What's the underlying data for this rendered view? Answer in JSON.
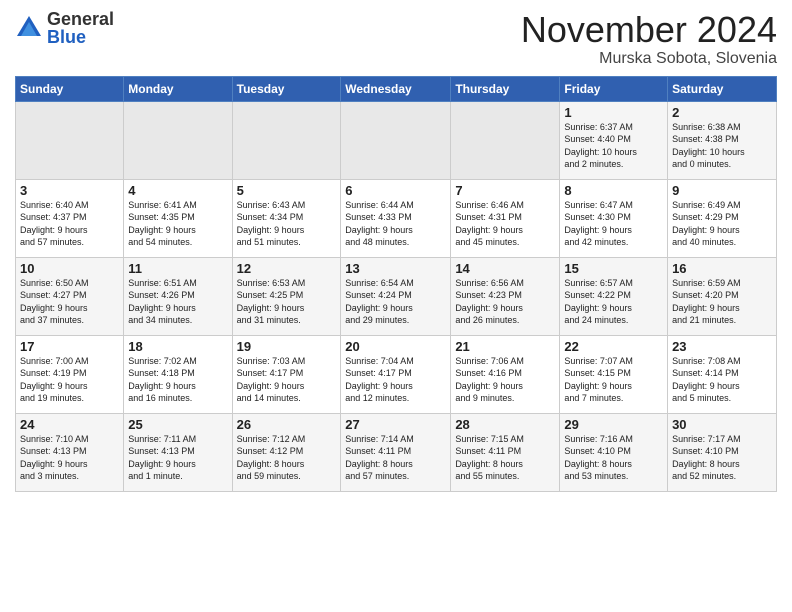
{
  "logo": {
    "general": "General",
    "blue": "Blue"
  },
  "header": {
    "month": "November 2024",
    "location": "Murska Sobota, Slovenia"
  },
  "weekdays": [
    "Sunday",
    "Monday",
    "Tuesday",
    "Wednesday",
    "Thursday",
    "Friday",
    "Saturday"
  ],
  "weeks": [
    [
      {
        "day": "",
        "info": ""
      },
      {
        "day": "",
        "info": ""
      },
      {
        "day": "",
        "info": ""
      },
      {
        "day": "",
        "info": ""
      },
      {
        "day": "",
        "info": ""
      },
      {
        "day": "1",
        "info": "Sunrise: 6:37 AM\nSunset: 4:40 PM\nDaylight: 10 hours\nand 2 minutes."
      },
      {
        "day": "2",
        "info": "Sunrise: 6:38 AM\nSunset: 4:38 PM\nDaylight: 10 hours\nand 0 minutes."
      }
    ],
    [
      {
        "day": "3",
        "info": "Sunrise: 6:40 AM\nSunset: 4:37 PM\nDaylight: 9 hours\nand 57 minutes."
      },
      {
        "day": "4",
        "info": "Sunrise: 6:41 AM\nSunset: 4:35 PM\nDaylight: 9 hours\nand 54 minutes."
      },
      {
        "day": "5",
        "info": "Sunrise: 6:43 AM\nSunset: 4:34 PM\nDaylight: 9 hours\nand 51 minutes."
      },
      {
        "day": "6",
        "info": "Sunrise: 6:44 AM\nSunset: 4:33 PM\nDaylight: 9 hours\nand 48 minutes."
      },
      {
        "day": "7",
        "info": "Sunrise: 6:46 AM\nSunset: 4:31 PM\nDaylight: 9 hours\nand 45 minutes."
      },
      {
        "day": "8",
        "info": "Sunrise: 6:47 AM\nSunset: 4:30 PM\nDaylight: 9 hours\nand 42 minutes."
      },
      {
        "day": "9",
        "info": "Sunrise: 6:49 AM\nSunset: 4:29 PM\nDaylight: 9 hours\nand 40 minutes."
      }
    ],
    [
      {
        "day": "10",
        "info": "Sunrise: 6:50 AM\nSunset: 4:27 PM\nDaylight: 9 hours\nand 37 minutes."
      },
      {
        "day": "11",
        "info": "Sunrise: 6:51 AM\nSunset: 4:26 PM\nDaylight: 9 hours\nand 34 minutes."
      },
      {
        "day": "12",
        "info": "Sunrise: 6:53 AM\nSunset: 4:25 PM\nDaylight: 9 hours\nand 31 minutes."
      },
      {
        "day": "13",
        "info": "Sunrise: 6:54 AM\nSunset: 4:24 PM\nDaylight: 9 hours\nand 29 minutes."
      },
      {
        "day": "14",
        "info": "Sunrise: 6:56 AM\nSunset: 4:23 PM\nDaylight: 9 hours\nand 26 minutes."
      },
      {
        "day": "15",
        "info": "Sunrise: 6:57 AM\nSunset: 4:22 PM\nDaylight: 9 hours\nand 24 minutes."
      },
      {
        "day": "16",
        "info": "Sunrise: 6:59 AM\nSunset: 4:20 PM\nDaylight: 9 hours\nand 21 minutes."
      }
    ],
    [
      {
        "day": "17",
        "info": "Sunrise: 7:00 AM\nSunset: 4:19 PM\nDaylight: 9 hours\nand 19 minutes."
      },
      {
        "day": "18",
        "info": "Sunrise: 7:02 AM\nSunset: 4:18 PM\nDaylight: 9 hours\nand 16 minutes."
      },
      {
        "day": "19",
        "info": "Sunrise: 7:03 AM\nSunset: 4:17 PM\nDaylight: 9 hours\nand 14 minutes."
      },
      {
        "day": "20",
        "info": "Sunrise: 7:04 AM\nSunset: 4:17 PM\nDaylight: 9 hours\nand 12 minutes."
      },
      {
        "day": "21",
        "info": "Sunrise: 7:06 AM\nSunset: 4:16 PM\nDaylight: 9 hours\nand 9 minutes."
      },
      {
        "day": "22",
        "info": "Sunrise: 7:07 AM\nSunset: 4:15 PM\nDaylight: 9 hours\nand 7 minutes."
      },
      {
        "day": "23",
        "info": "Sunrise: 7:08 AM\nSunset: 4:14 PM\nDaylight: 9 hours\nand 5 minutes."
      }
    ],
    [
      {
        "day": "24",
        "info": "Sunrise: 7:10 AM\nSunset: 4:13 PM\nDaylight: 9 hours\nand 3 minutes."
      },
      {
        "day": "25",
        "info": "Sunrise: 7:11 AM\nSunset: 4:13 PM\nDaylight: 9 hours\nand 1 minute."
      },
      {
        "day": "26",
        "info": "Sunrise: 7:12 AM\nSunset: 4:12 PM\nDaylight: 8 hours\nand 59 minutes."
      },
      {
        "day": "27",
        "info": "Sunrise: 7:14 AM\nSunset: 4:11 PM\nDaylight: 8 hours\nand 57 minutes."
      },
      {
        "day": "28",
        "info": "Sunrise: 7:15 AM\nSunset: 4:11 PM\nDaylight: 8 hours\nand 55 minutes."
      },
      {
        "day": "29",
        "info": "Sunrise: 7:16 AM\nSunset: 4:10 PM\nDaylight: 8 hours\nand 53 minutes."
      },
      {
        "day": "30",
        "info": "Sunrise: 7:17 AM\nSunset: 4:10 PM\nDaylight: 8 hours\nand 52 minutes."
      }
    ]
  ]
}
